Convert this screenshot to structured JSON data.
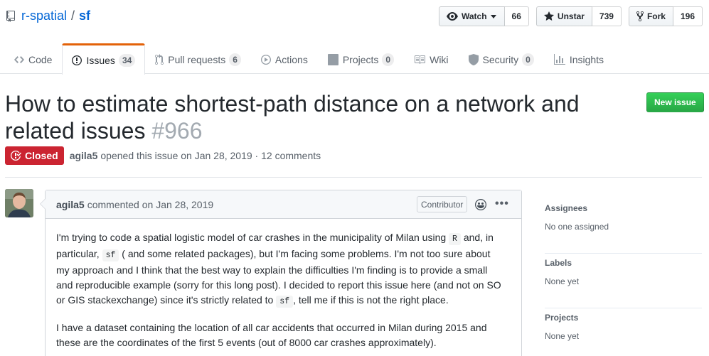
{
  "repo": {
    "owner": "r-spatial",
    "separator": "/",
    "name": "sf"
  },
  "actions": {
    "watch": {
      "label": "Watch",
      "count": "66"
    },
    "star": {
      "label": "Unstar",
      "count": "739"
    },
    "fork": {
      "label": "Fork",
      "count": "196"
    }
  },
  "nav": {
    "code": {
      "label": "Code"
    },
    "issues": {
      "label": "Issues",
      "count": "34"
    },
    "pulls": {
      "label": "Pull requests",
      "count": "6"
    },
    "actions": {
      "label": "Actions"
    },
    "projects": {
      "label": "Projects",
      "count": "0"
    },
    "wiki": {
      "label": "Wiki"
    },
    "security": {
      "label": "Security",
      "count": "0"
    },
    "insights": {
      "label": "Insights"
    }
  },
  "issue": {
    "title": "How to estimate shortest-path distance on a network and related issues",
    "number": "#966",
    "state": "Closed",
    "author": "agila5",
    "meta": "opened this issue on Jan 28, 2019 · 12 comments",
    "new_issue_label": "New issue"
  },
  "comment": {
    "author": "agila5",
    "date_text": "commented on Jan 28, 2019",
    "role": "Contributor",
    "p1": {
      "t1": "I'm trying to code a spatial logistic model of car crashes in the municipality of Milan using ",
      "c1": "R",
      "t2": " and, in particular, ",
      "c2": "sf",
      "t3": " ( and some related packages), but I'm facing some problems. I'm not too sure about my approach and I think that the best way to explain the difficulties I'm finding is to provide a small and reproducible example (sorry for this long post). I decided to report this issue here (and not on SO or GIS stackexchange) since it's strictly related to ",
      "c3": "sf",
      "t4": ", tell me if this is not the right place."
    },
    "p2": "I have a dataset containing the location of all car accidents that occurred in Milan during 2015 and these are the coordinates of the first 5 events (out of 8000 car crashes approximately)."
  },
  "sidebar": {
    "assignees": {
      "heading": "Assignees",
      "value": "No one assigned"
    },
    "labels": {
      "heading": "Labels",
      "value": "None yet"
    },
    "projects": {
      "heading": "Projects",
      "value": "None yet"
    }
  },
  "colors": {
    "closed": "#cb2431",
    "new_issue": "#28a745",
    "link": "#0366d6",
    "selected_tab_accent": "#e36209"
  }
}
